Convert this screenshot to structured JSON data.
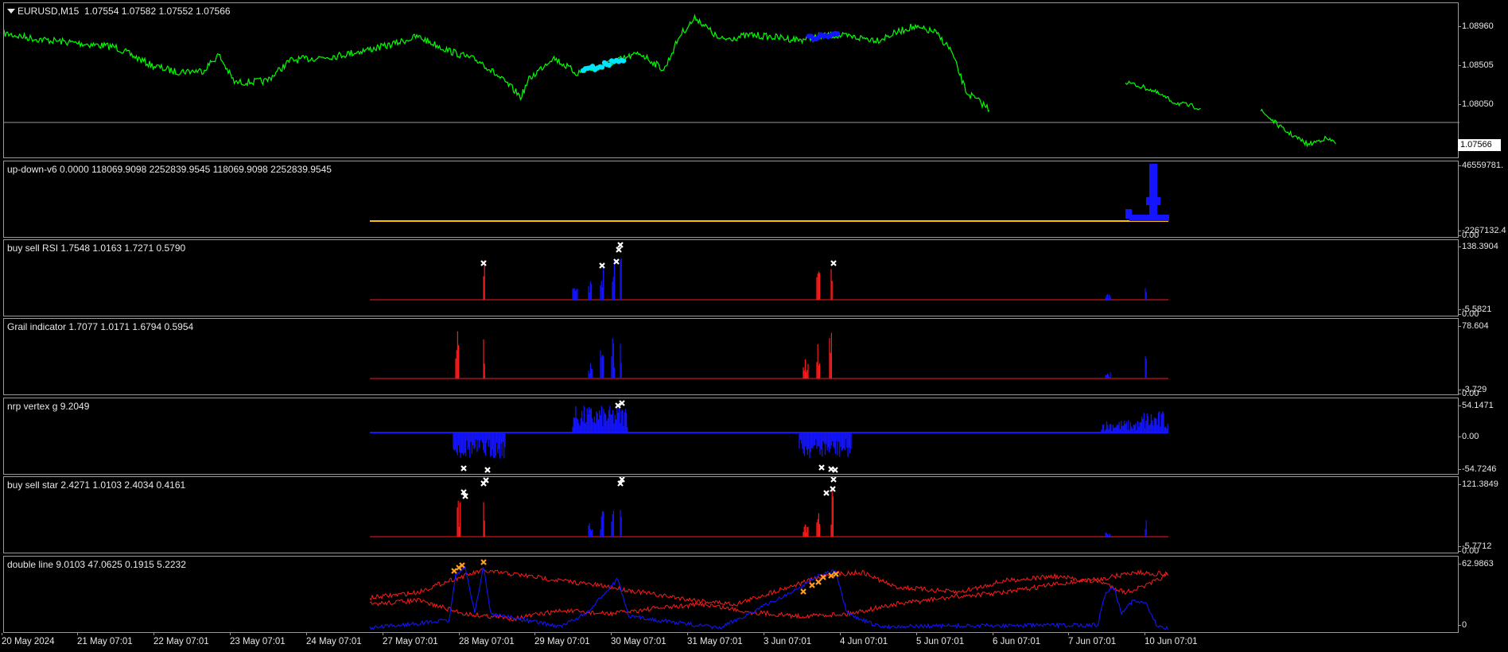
{
  "main": {
    "symbol": "EURUSD,M15",
    "ohlc": "1.07554 1.07582 1.07552 1.07566",
    "price_ticks": [
      "1.08960",
      "1.08505",
      "1.08050"
    ],
    "current_price": "1.07566",
    "line_color": "#00ff00"
  },
  "panes": [
    {
      "title": "up-down-v6 0.0000 118069.9098 2252839.9545 118069.9098 2252839.9545",
      "ticks": [
        "46559781.",
        "-2267132.4",
        "0.00"
      ]
    },
    {
      "title": "buy sell RSI 1.7548 1.0163 1.7271 0.5790",
      "ticks": [
        "138.3904",
        "-5.5821",
        "0.00"
      ]
    },
    {
      "title": "Grail indicator 1.7077 1.0171 1.6794 0.5954",
      "ticks": [
        "78.604",
        "-3.729",
        "0.00"
      ]
    },
    {
      "title": "nrp vertex g 9.2049",
      "ticks": [
        "54.1471",
        "0.00",
        "-54.7246"
      ]
    },
    {
      "title": "buy sell star 2.4271 1.0103 2.4034 0.4161",
      "ticks": [
        "121.3849",
        "-5.7712",
        "0.00"
      ]
    },
    {
      "title": "double line 9.0103 47.0625 0.1915 5.2232",
      "ticks": [
        "62.9863",
        "0"
      ]
    }
  ],
  "time_axis": [
    "20 May 2024",
    "21 May 07:01",
    "22 May 07:01",
    "23 May 07:01",
    "24 May 07:01",
    "27 May 07:01",
    "28 May 07:01",
    "29 May 07:01",
    "30 May 07:01",
    "31 May 07:01",
    "3 Jun 07:01",
    "4 Jun 07:01",
    "5 Jun 07:01",
    "6 Jun 07:01",
    "7 Jun 07:01",
    "10 Jun 07:01"
  ],
  "colors": {
    "sell": "#ff1a1a",
    "buy": "#1414ff",
    "level": "#ffc000",
    "marker": "#ffffff",
    "marker_orange": "#ffa020",
    "cyan": "#00e5ff",
    "grid": "#9a9a9a"
  }
}
